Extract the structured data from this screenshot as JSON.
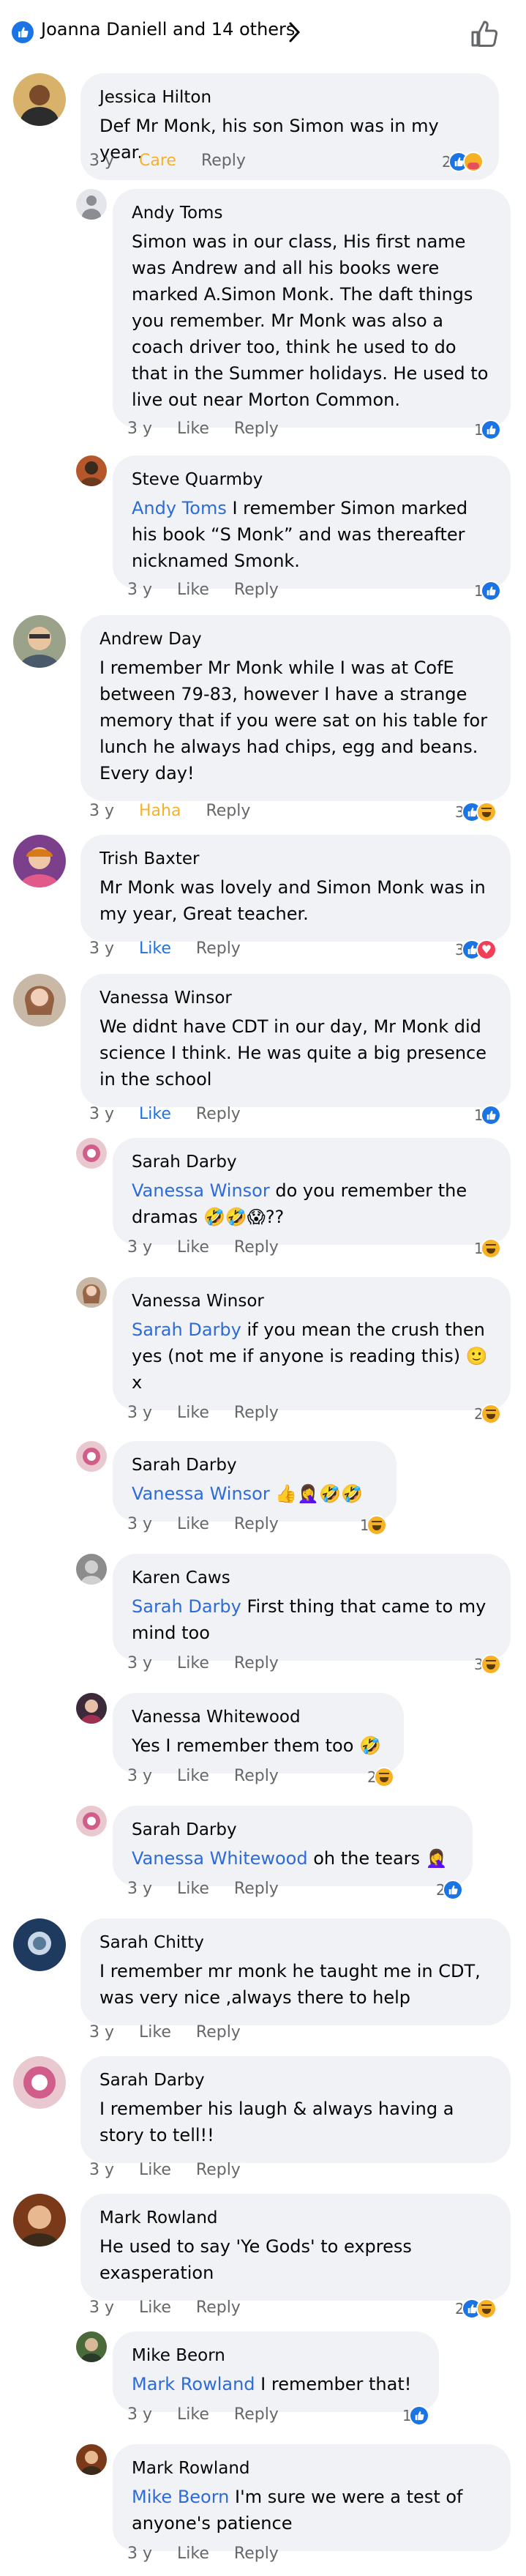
{
  "header": {
    "reactors_text": "Joanna Daniell and 14 others"
  },
  "colors": {
    "like_blue": "#1b74e4",
    "bubble_bg": "#f0f2f5",
    "mention": "#2d6bd8",
    "meta_gray": "#65676b",
    "care_yellow": "#f7b125"
  },
  "comments": [
    {
      "author": "Jessica Hilton",
      "text": "Def Mr Monk, his son Simon was in my year.",
      "time": "3 y",
      "reaction_label": "Care",
      "reply_label": "Reply",
      "reaction_count": "2",
      "reactions": [
        "like",
        "care"
      ]
    },
    {
      "author": "Andy Toms",
      "text": "Simon was in our class, His first name was Andrew and all his books were marked A.Simon Monk. The daft things you remember. Mr Monk was also a coach driver too, think he used to do that in the Summer holidays. He used to live out near Morton Common.",
      "time": "3 y",
      "reaction_label": "Like",
      "reply_label": "Reply",
      "reaction_count": "1",
      "reactions": [
        "like"
      ]
    },
    {
      "author": "Steve Quarmby",
      "mention": "Andy Toms",
      "text": " I remember Simon marked his book “S Monk” and was thereafter nicknamed Smonk.",
      "time": "3 y",
      "reaction_label": "Like",
      "reply_label": "Reply",
      "reaction_count": "1",
      "reactions": [
        "like"
      ]
    },
    {
      "author": "Andrew Day",
      "text": "I remember Mr Monk while I was at CofE between 79-83, however I have a strange memory that if you were sat on his table for lunch he always had chips, egg and beans. Every day!",
      "time": "3 y",
      "reaction_label": "Haha",
      "reply_label": "Reply",
      "reaction_count": "3",
      "reactions": [
        "like",
        "haha"
      ]
    },
    {
      "author": "Trish Baxter",
      "text": "Mr Monk was lovely and Simon Monk was in my year, Great teacher.",
      "time": "3 y",
      "reaction_label": "Like",
      "reply_label": "Reply",
      "reaction_count": "3",
      "reactions": [
        "like",
        "love"
      ]
    },
    {
      "author": "Vanessa Winsor",
      "text": "We didnt have CDT in our day, Mr Monk did science I think. He was quite a big presence in the school",
      "time": "3 y",
      "reaction_label": "Like",
      "reply_label": "Reply",
      "reaction_count": "1",
      "reactions": [
        "like"
      ]
    },
    {
      "author": "Sarah Darby",
      "mention": "Vanessa Winsor",
      "text": " do you remember the dramas 🤣🤣😱??",
      "time": "3 y",
      "reaction_label": "Like",
      "reply_label": "Reply",
      "reaction_count": "1",
      "reactions": [
        "haha"
      ]
    },
    {
      "author": "Vanessa Winsor",
      "mention": "Sarah Darby",
      "text": " if you mean the crush then yes (not me if anyone is reading this) 🙂 x",
      "time": "3 y",
      "reaction_label": "Like",
      "reply_label": "Reply",
      "reaction_count": "2",
      "reactions": [
        "haha"
      ]
    },
    {
      "author": "Sarah Darby",
      "mention": "Vanessa Winsor",
      "text": " 👍🤦‍♀️🤣🤣",
      "time": "3 y",
      "reaction_label": "Like",
      "reply_label": "Reply",
      "reaction_count": "1",
      "reactions": [
        "haha"
      ]
    },
    {
      "author": "Karen Caws",
      "mention": "Sarah Darby",
      "text": " First thing that came to my mind too",
      "time": "3 y",
      "reaction_label": "Like",
      "reply_label": "Reply",
      "reaction_count": "3",
      "reactions": [
        "haha"
      ]
    },
    {
      "author": "Vanessa Whitewood",
      "text": "Yes I remember them too 🤣",
      "time": "3 y",
      "reaction_label": "Like",
      "reply_label": "Reply",
      "reaction_count": "2",
      "reactions": [
        "haha"
      ]
    },
    {
      "author": "Sarah Darby",
      "mention": "Vanessa Whitewood",
      "text": " oh the tears 🤦‍♀️",
      "time": "3 y",
      "reaction_label": "Like",
      "reply_label": "Reply",
      "reaction_count": "2",
      "reactions": [
        "like"
      ]
    },
    {
      "author": "Sarah Chitty",
      "text": "I remember mr monk he taught me in CDT, was very nice ,always there to help",
      "time": "3 y",
      "reaction_label": "Like",
      "reply_label": "Reply",
      "reaction_count": "",
      "reactions": []
    },
    {
      "author": "Sarah Darby",
      "text": "I remember his laugh & always having a story to tell!!",
      "time": "3 y",
      "reaction_label": "Like",
      "reply_label": "Reply",
      "reaction_count": "",
      "reactions": []
    },
    {
      "author": "Mark Rowland",
      "text": "He used to say 'Ye Gods' to express exasperation",
      "time": "3 y",
      "reaction_label": "Like",
      "reply_label": "Reply",
      "reaction_count": "2",
      "reactions": [
        "like",
        "haha"
      ]
    },
    {
      "author": "Mike Beorn",
      "mention": "Mark Rowland",
      "text": " I remember that!",
      "time": "3 y",
      "reaction_label": "Like",
      "reply_label": "Reply",
      "reaction_count": "1",
      "reactions": [
        "like"
      ]
    },
    {
      "author": "Mark Rowland",
      "mention": "Mike Beorn",
      "text": " I'm sure we were a test of anyone's patience",
      "time": "3 y",
      "reaction_label": "Like",
      "reply_label": "Reply",
      "reaction_count": "",
      "reactions": []
    }
  ]
}
